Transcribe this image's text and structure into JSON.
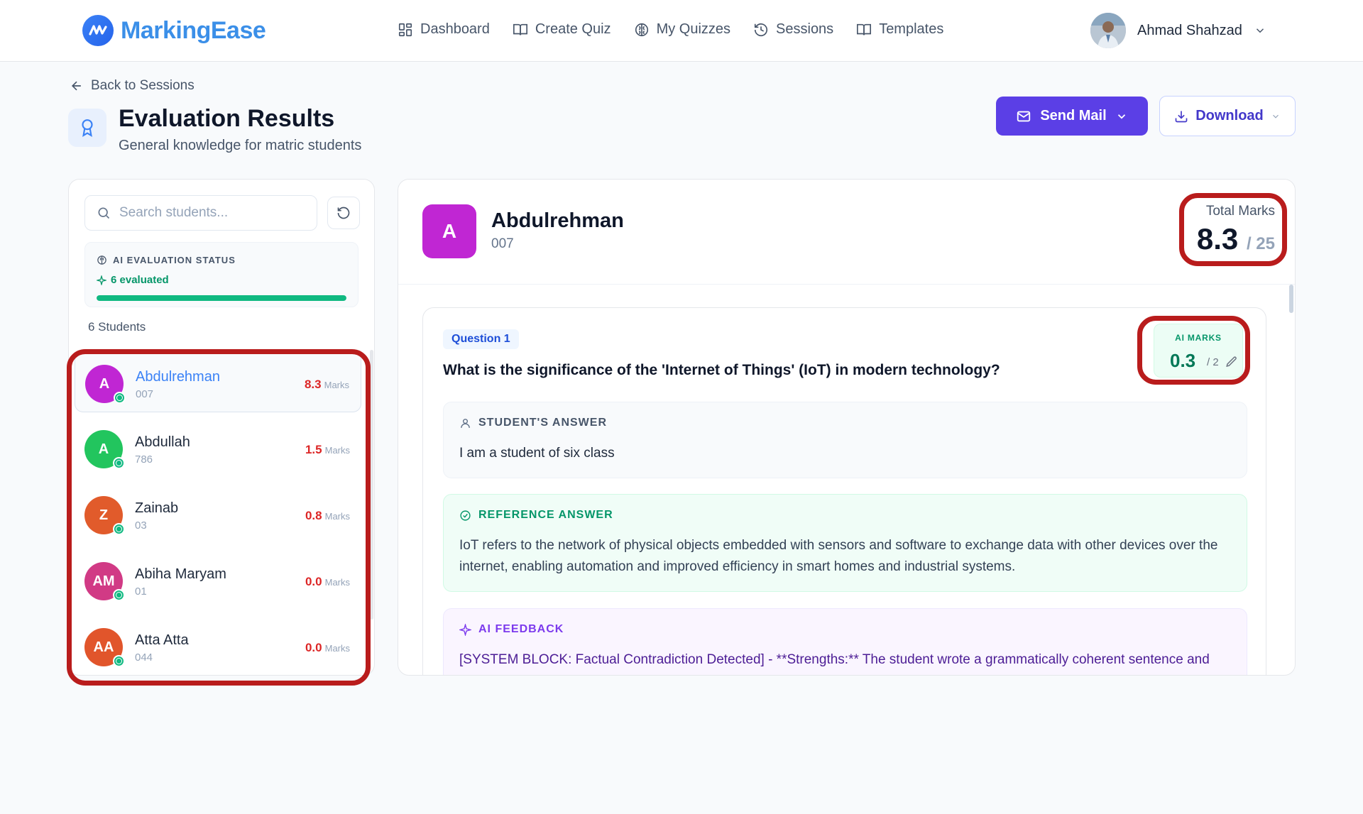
{
  "app": {
    "name": "MarkingEase"
  },
  "nav": {
    "items": [
      {
        "label": "Dashboard",
        "icon": "grid-icon"
      },
      {
        "label": "Create Quiz",
        "icon": "book-icon"
      },
      {
        "label": "My Quizzes",
        "icon": "brain-icon"
      },
      {
        "label": "Sessions",
        "icon": "history-icon"
      },
      {
        "label": "Templates",
        "icon": "book-icon"
      }
    ]
  },
  "user": {
    "name": "Ahmad Shahzad"
  },
  "header": {
    "back_label": "Back to Sessions",
    "title": "Evaluation Results",
    "subtitle": "General knowledge for matric students",
    "send_mail_label": "Send Mail",
    "download_label": "Download"
  },
  "sidebar": {
    "search_placeholder": "Search students...",
    "ai_status": {
      "heading": "AI EVALUATION STATUS",
      "count_label": "6 evaluated",
      "progress_percent": 100
    },
    "students_count": "6 Students",
    "marks_unit": "Marks",
    "students": [
      {
        "initials": "A",
        "name": "Abdulrehman",
        "id": "007",
        "marks": "8.3",
        "color": "#c026d3",
        "active": true
      },
      {
        "initials": "A",
        "name": "Abdullah",
        "id": "786",
        "marks": "1.5",
        "color": "#22c55e",
        "active": false
      },
      {
        "initials": "Z",
        "name": "Zainab",
        "id": "03",
        "marks": "0.8",
        "color": "#e15b2b",
        "active": false
      },
      {
        "initials": "AM",
        "name": "Abiha Maryam",
        "id": "01",
        "marks": "0.0",
        "color": "#d13a85",
        "active": false
      },
      {
        "initials": "AA",
        "name": "Atta Atta",
        "id": "044",
        "marks": "0.0",
        "color": "#e1552b",
        "active": false
      }
    ]
  },
  "main": {
    "student": {
      "initials": "A",
      "name": "Abdulrehman",
      "id": "007"
    },
    "total_label": "Total Marks",
    "total_value": "8.3",
    "total_max": "/ 25",
    "question": {
      "badge": "Question 1",
      "text": "What is the significance of the 'Internet of Things' (IoT) in modern technology?",
      "ai_marks_label": "AI MARKS",
      "ai_marks_value": "0.3",
      "ai_marks_max": "/ 2",
      "student_answer_heading": "STUDENT'S ANSWER",
      "student_answer": "I am a student of six class",
      "reference_heading": "REFERENCE ANSWER",
      "reference_answer": "IoT refers to the network of physical objects embedded with sensors and software to exchange data with other devices over the internet, enabling automation and improved efficiency in smart homes and industrial systems.",
      "feedback_heading": "AI FEEDBACK",
      "feedback": "[SYSTEM BLOCK: Factual Contradiction Detected] - **Strengths:** The student wrote a grammatically coherent sentence and identified their grade level."
    }
  },
  "colors": {
    "brand": "#3b8fe8",
    "primary_button": "#5b3fe6",
    "highlight": "#b91c1c",
    "success": "#10b981",
    "marks_red": "#dc2626"
  }
}
